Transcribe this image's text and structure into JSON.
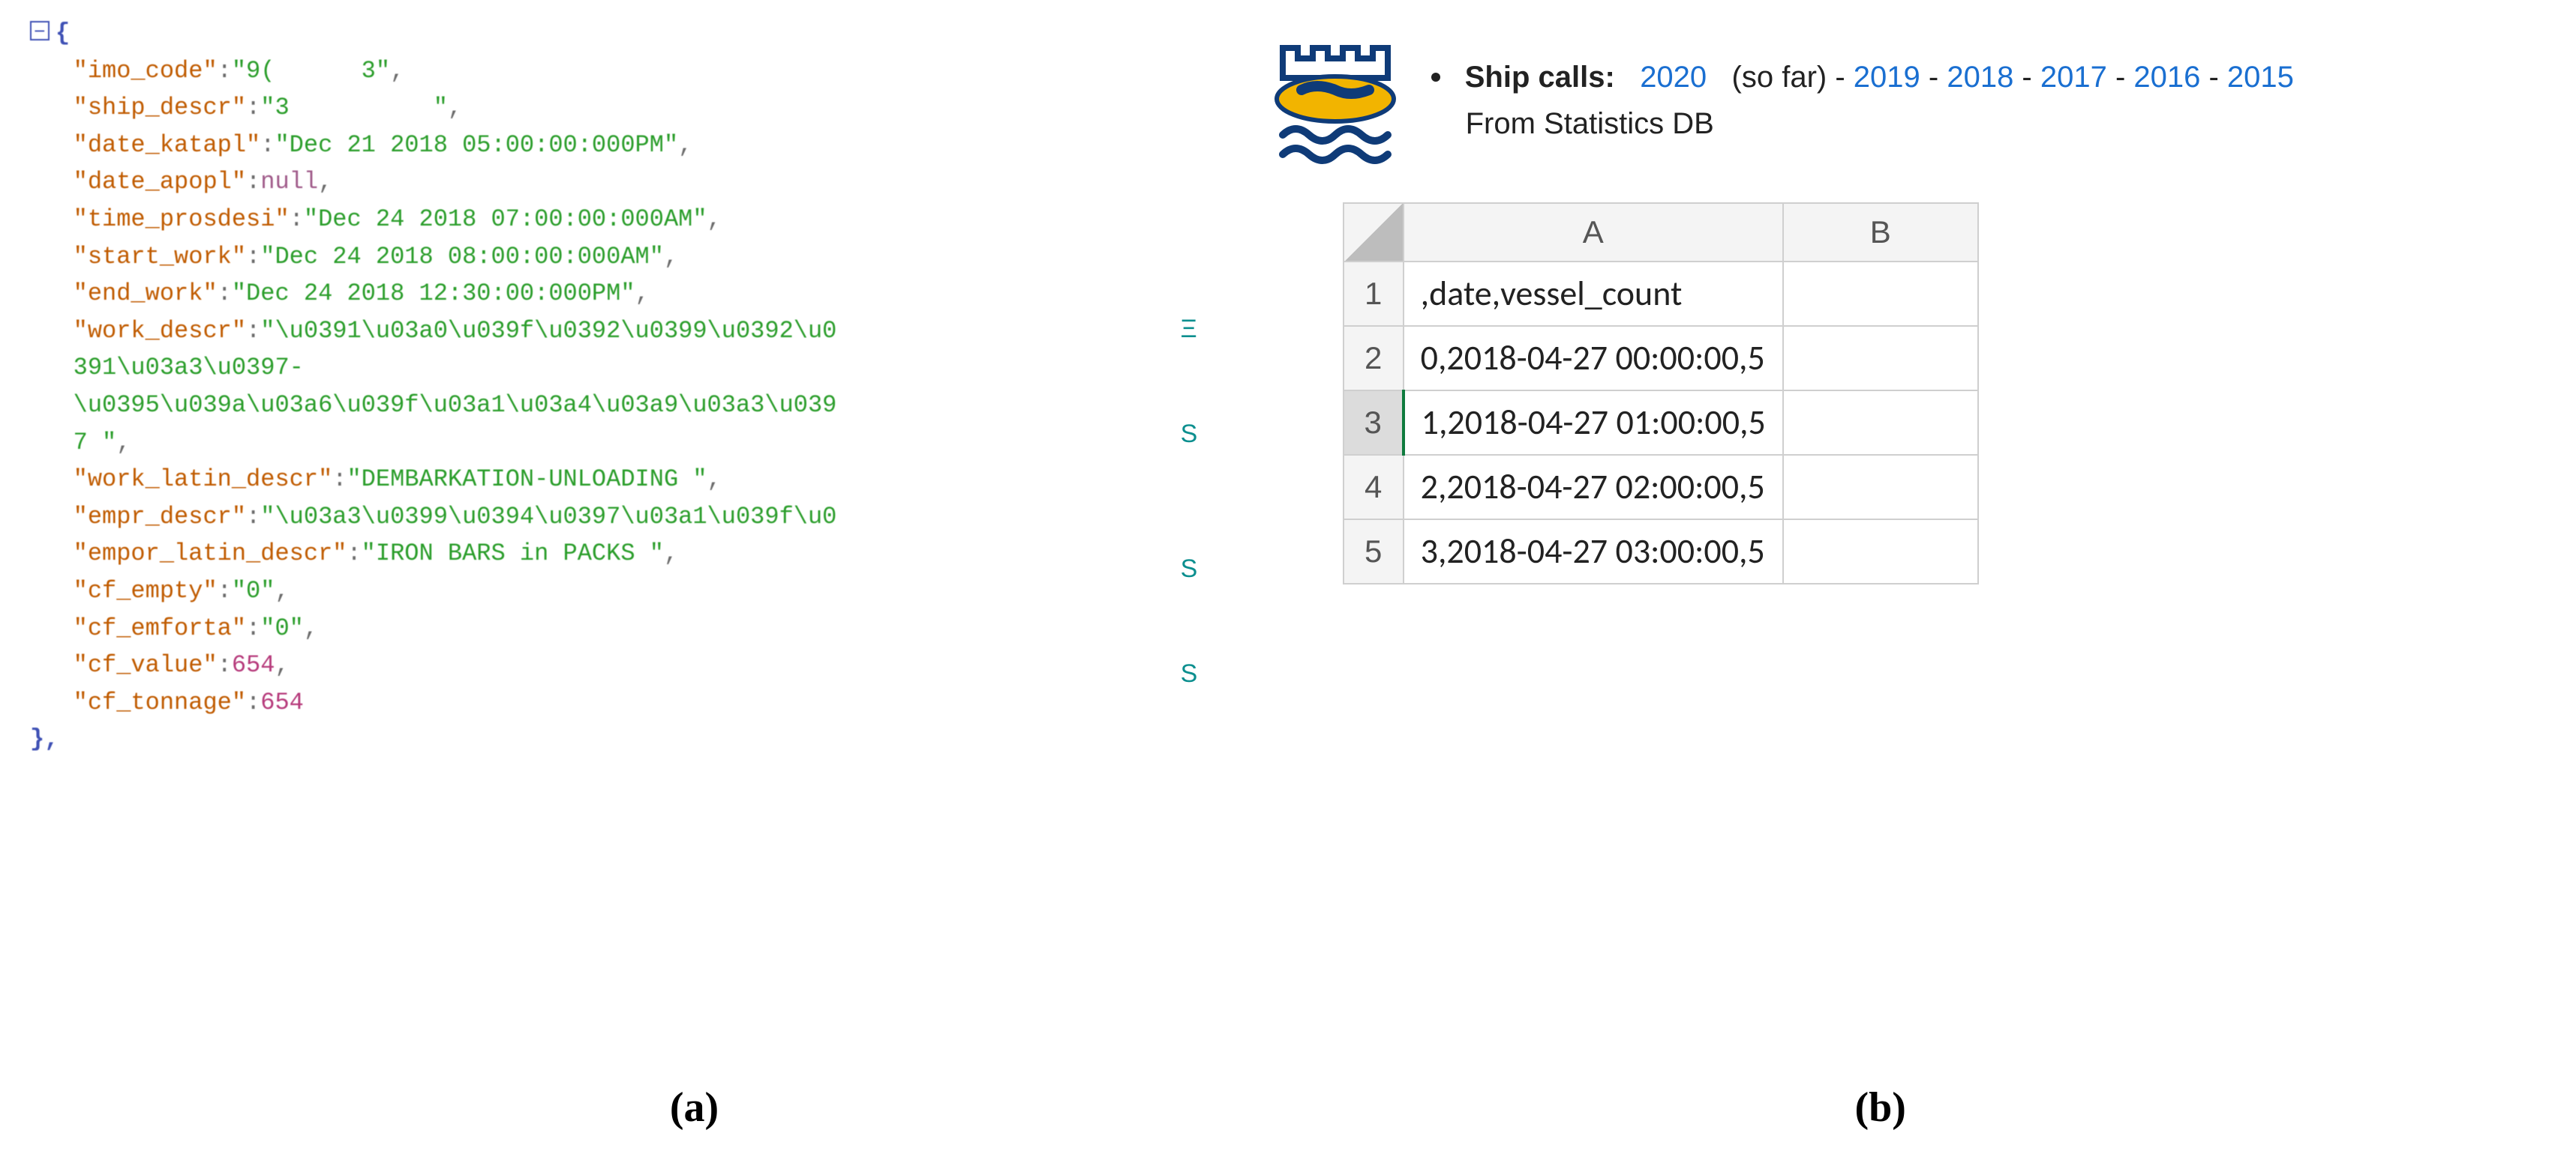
{
  "left_json": {
    "open_brace": "{",
    "close_brace": "},",
    "fields": [
      {
        "key": "\"imo_code\"",
        "colon": ":",
        "val": "\"9(      3\"",
        "type": "string",
        "trail": ","
      },
      {
        "key": "\"ship_descr\"",
        "colon": ":",
        "val": "\"3          \"",
        "type": "string",
        "trail": ","
      },
      {
        "key": "\"date_katapl\"",
        "colon": ":",
        "val": "\"Dec 21 2018 05:00:00:000PM\"",
        "type": "string",
        "trail": ","
      },
      {
        "key": "\"date_apopl\"",
        "colon": ":",
        "val": "null",
        "type": "null",
        "trail": ","
      },
      {
        "key": "\"time_prosdesi\"",
        "colon": ":",
        "val": "\"Dec 24 2018 07:00:00:000AM\"",
        "type": "string",
        "trail": ","
      },
      {
        "key": "\"start_work\"",
        "colon": ":",
        "val": "\"Dec 24 2018 08:00:00:000AM\"",
        "type": "string",
        "trail": ","
      },
      {
        "key": "\"end_work\"",
        "colon": ":",
        "val": "\"Dec 24 2018 12:30:00:000PM\"",
        "type": "string",
        "trail": ","
      },
      {
        "key": "\"work_descr\"",
        "colon": ":",
        "val": "\"\\u0391\\u03a0\\u039f\\u0392\\u0399\\u0392\\u0",
        "type": "string",
        "trail": ""
      },
      {
        "key": "",
        "colon": "",
        "val": "391\\u03a3\\u0397-",
        "type": "string",
        "trail": ""
      },
      {
        "key": "",
        "colon": "",
        "val": "\\u0395\\u039a\\u03a6\\u039f\\u03a1\\u03a4\\u03a9\\u03a3\\u039",
        "type": "string",
        "trail": ""
      },
      {
        "key": "",
        "colon": "",
        "val": "7 \"",
        "type": "string",
        "trail": ","
      },
      {
        "key": "\"work_latin_descr\"",
        "colon": ":",
        "val": "\"DEMBARKATION-UNLOADING \"",
        "type": "string",
        "trail": ","
      },
      {
        "key": "\"empr_descr\"",
        "colon": ":",
        "val": "\"\\u03a3\\u0399\\u0394\\u0397\\u03a1\\u039f\\u0",
        "type": "string",
        "trail": ""
      },
      {
        "key": "\"empor_latin_descr\"",
        "colon": ":",
        "val": "\"IRON BARS in PACKS \"",
        "type": "string",
        "trail": ","
      },
      {
        "key": "\"cf_empty\"",
        "colon": ":",
        "val": "\"0\"",
        "type": "string",
        "trail": ","
      },
      {
        "key": "\"cf_emforta\"",
        "colon": ":",
        "val": "\"0\"",
        "type": "string",
        "trail": ","
      },
      {
        "key": "\"cf_value\"",
        "colon": ":",
        "val": "654",
        "type": "number",
        "trail": ","
      },
      {
        "key": "\"cf_tonnage\"",
        "colon": ":",
        "val": "654",
        "type": "number",
        "trail": ""
      }
    ]
  },
  "right_header": {
    "label": "Ship calls:",
    "year_active": "2020",
    "paren": "(so far)",
    "years": [
      "2019",
      "2018",
      "2017",
      "2016",
      "2015"
    ],
    "dash": " - ",
    "subtitle": "From Statistics DB"
  },
  "sheet": {
    "col_headers": [
      "A",
      "B"
    ],
    "rows": [
      {
        "hdr": "1",
        "a": ",date,vessel_count",
        "b": ""
      },
      {
        "hdr": "2",
        "a": "0,2018-04-27 00:00:00,5",
        "b": ""
      },
      {
        "hdr": "3",
        "a": "1,2018-04-27 01:00:00,5",
        "b": "",
        "selected": true
      },
      {
        "hdr": "4",
        "a": "2,2018-04-27 02:00:00,5",
        "b": ""
      },
      {
        "hdr": "5",
        "a": "3,2018-04-27 03:00:00,5",
        "b": ""
      }
    ]
  },
  "captions": {
    "a": "(a)",
    "b": "(b)"
  }
}
